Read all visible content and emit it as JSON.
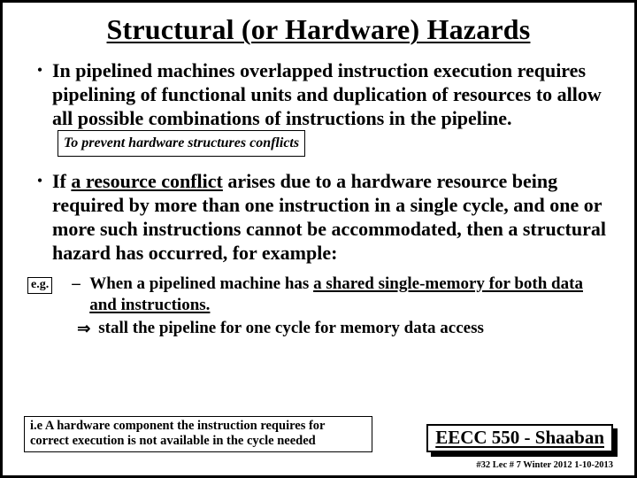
{
  "title": "Structural (or Hardware) Hazards",
  "bullets": {
    "b1_pre": "In pipelined machines  overlapped instruction execution requires pipelining of functional units and duplication of resources to allow all possible combinations of instructions in the pipeline.",
    "b1_note": "To prevent hardware structures conflicts",
    "b2_pre": "If ",
    "b2_ul": "a resource conflict",
    "b2_post": " arises due to a hardware resource being required by more than one instruction in a single cycle, and one or more such instructions cannot be accommodated,  then a structural hazard has occurred, for example:"
  },
  "eg_label": "e.g.",
  "sub": {
    "pre": "When a pipelined machine has ",
    "ul1": "a shared single-memory for both data and instructions.",
    "arrow_text": "stall the pipeline for one cycle for memory data access"
  },
  "foot_note": "i.e A hardware component the instruction requires for correct execution is not available in the cycle needed",
  "course": "EECC 550 - Shaaban",
  "pageinfo": "#32   Lec # 7  Winter 2012  1-10-2013"
}
